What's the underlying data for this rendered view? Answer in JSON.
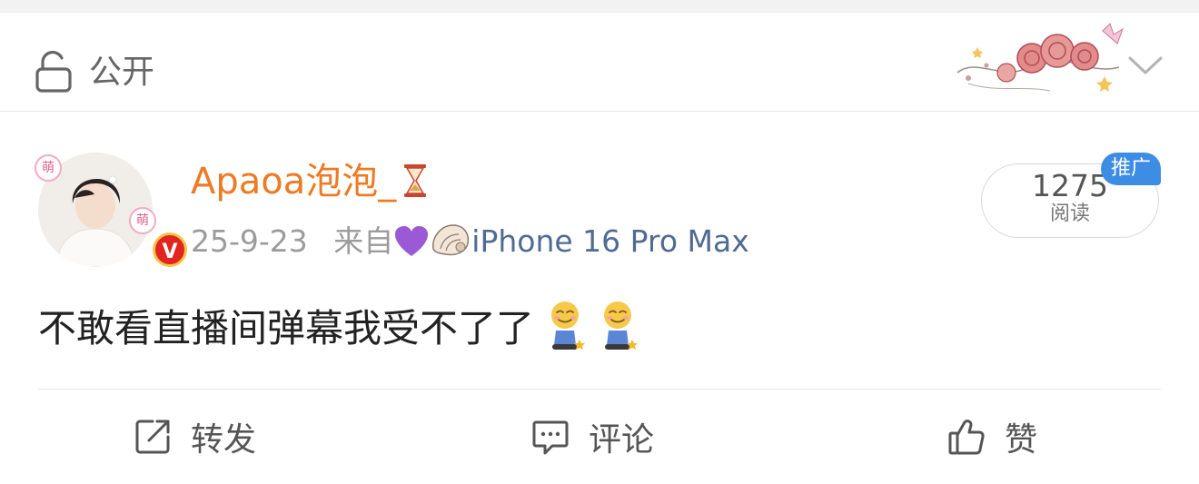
{
  "visibility": {
    "label": "公开",
    "icon": "lock-open-icon"
  },
  "post": {
    "username": "Apaoa泡泡_",
    "date": "25-9-23",
    "source_prefix": "来自",
    "source_emojis": [
      "💜",
      "🐚"
    ],
    "device": "iPhone 16 Pro Max",
    "text": "不敢看直播间弹幕我受不了了",
    "avatar_badges": [
      "萌",
      "萌",
      "V"
    ],
    "verified_badge_color": "#e2251f"
  },
  "reads": {
    "count": "1275",
    "label": "阅读",
    "promo_badge": "推广"
  },
  "actions": {
    "repost": "转发",
    "comment": "评论",
    "like": "赞"
  },
  "colors": {
    "username": "#ee7a23",
    "device_link": "#506b93",
    "promo_badge": "#3d8de4",
    "meta_text": "#9b9b9b"
  }
}
